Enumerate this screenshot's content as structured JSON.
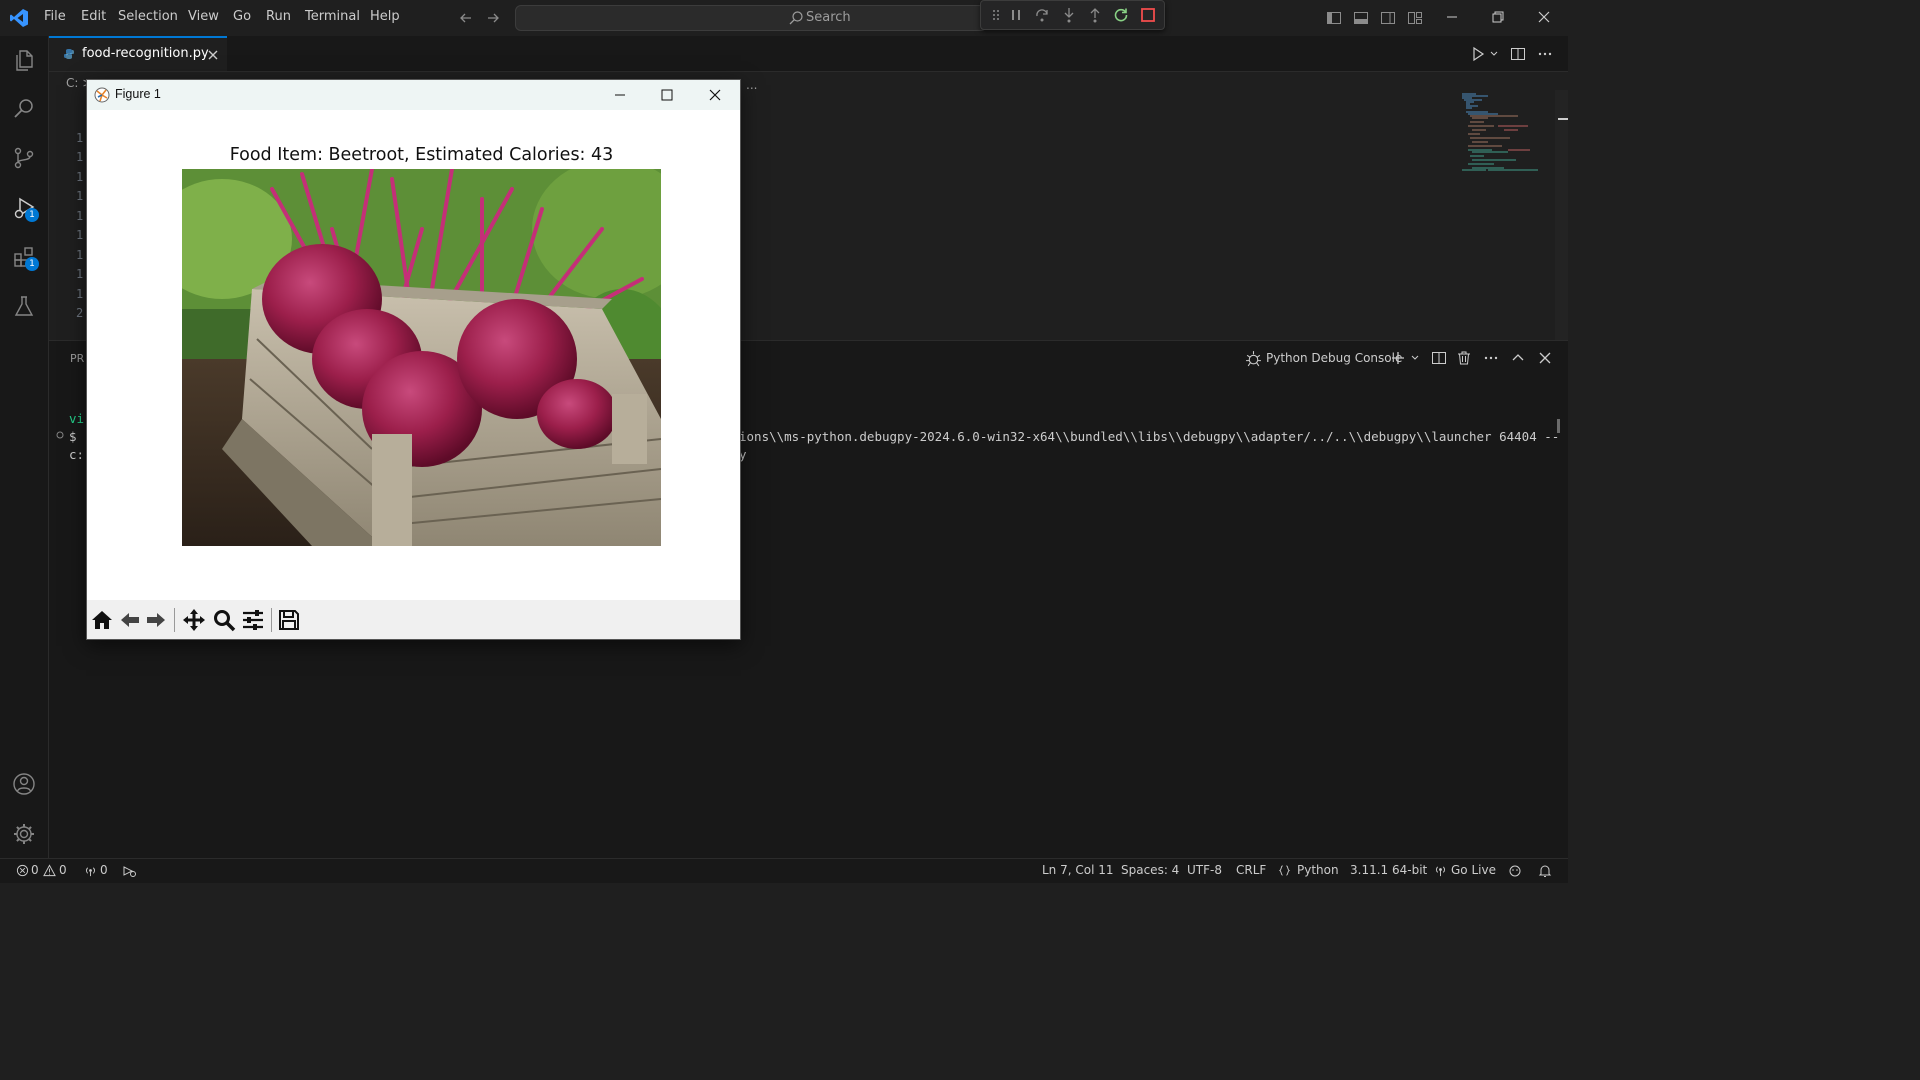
{
  "menu": [
    "File",
    "Edit",
    "Selection",
    "View",
    "Go",
    "Run",
    "Terminal",
    "Help"
  ],
  "search": {
    "placeholder": "Search"
  },
  "tab": {
    "filename": "food-recognition.py"
  },
  "breadcrumb": {
    "text": "C: >",
    "ellipsis": "..."
  },
  "line_numbers": [
    "1",
    "1",
    "1",
    "1",
    "1",
    "1",
    "1",
    "1",
    "1",
    "2"
  ],
  "badges": {
    "run_debug": "1",
    "extensions": "1"
  },
  "panel": {
    "tab_fragment": "PR",
    "console_label": "Python Debug Console",
    "term_lines": {
      "line1_left": "vi",
      "line2_left": "$",
      "line3_left": "c:",
      "line2_right": "ions\\\\ms-python.debugpy-2024.6.0-win32-x64\\\\bundled\\\\libs\\\\debugpy\\\\adapter/../..\\\\debugpy\\\\launcher 64404 --",
      "line3_right": "y"
    }
  },
  "figure": {
    "window_title": "Figure 1",
    "heading": "Food Item: Beetroot, Estimated Calories: 43",
    "image_subject": "beetroots in wooden crate"
  },
  "status": {
    "errors": "0",
    "warnings": "0",
    "ports": "0",
    "cursor": "Ln 7, Col 11",
    "spaces": "Spaces: 4",
    "encoding": "UTF-8",
    "eol": "CRLF",
    "language": "Python",
    "interpreter": "3.11.1 64-bit",
    "golive": "Go Live"
  },
  "colors": {
    "accent": "#0078d4",
    "bg": "#1f1f1f",
    "restart": "#89d185",
    "stop": "#f14c4c"
  }
}
